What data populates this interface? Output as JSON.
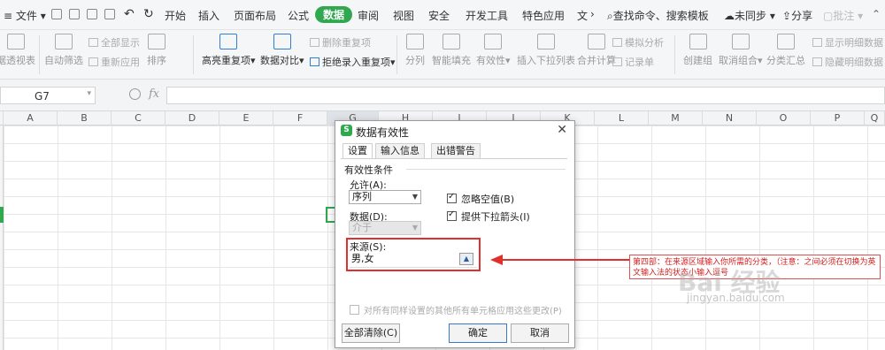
{
  "menubar": {
    "file_label": "文件",
    "items": [
      "开始",
      "插入",
      "页面布局",
      "公式",
      "数据",
      "审阅",
      "视图",
      "安全",
      "开发工具",
      "特色应用",
      "文"
    ],
    "active_item": "数据",
    "search_label": "查找命令、搜索模板",
    "sync_label": "未同步",
    "share_label": "分享",
    "comment_label": "批注"
  },
  "ribbon": {
    "pivot": "据透视表",
    "autofilter": "自动筛选",
    "show_all": "全部显示",
    "reapply": "重新应用",
    "sort": "排序",
    "highlight_dup": "高亮重复项",
    "compare": "数据对比",
    "remove_dup": "删除重复项",
    "reject_dup": "拒绝录入重复项",
    "split": "分列",
    "flash_fill": "智能填充",
    "validity": "有效性",
    "insert_dropdown": "插入下拉列表",
    "consolidate": "合并计算",
    "what_if": "模拟分析",
    "record": "记录单",
    "group": "创建组",
    "ungroup": "取消组合",
    "subtotal": "分类汇总",
    "show_detail": "显示明细数据",
    "hide_detail": "隐藏明细数据"
  },
  "formula_bar": {
    "cell_ref": "G7",
    "fx_label": "fx",
    "formula": ""
  },
  "columns": [
    "A",
    "B",
    "C",
    "D",
    "E",
    "F",
    "G",
    "H",
    "I",
    "J",
    "K",
    "L",
    "M",
    "N",
    "O",
    "P",
    "Q"
  ],
  "selected_column": "G",
  "dialog": {
    "title": "数据有效性",
    "tabs": [
      "设置",
      "输入信息",
      "出错警告"
    ],
    "criteria_label": "有效性条件",
    "allow_label": "允许(A):",
    "allow_value": "序列",
    "data_label": "数据(D):",
    "data_value": "介于",
    "ignore_blank": "忽略空值(B)",
    "dropdown": "提供下拉箭头(I)",
    "source_label": "来源(S):",
    "source_value": "男,女",
    "apply_all": "对所有同样设置的其他所有单元格应用这些更改(P)",
    "clear_button": "全部清除(C)",
    "ok_button": "确定",
    "cancel_button": "取消"
  },
  "annotation": {
    "text": "第四部：在来源区域输入你所需的分类，（注意：之间必须在切换为英文输入法的状态小输入逗号"
  },
  "watermark": {
    "brand": "Bai 经验",
    "url": "jingyan.baidu.com"
  },
  "colors": {
    "accent_green": "#2fa84f",
    "annotation_red": "#e0302c",
    "ok_border": "#3b78c9"
  }
}
